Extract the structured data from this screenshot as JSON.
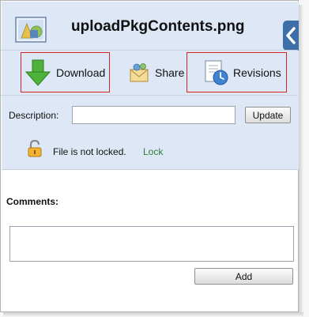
{
  "file": {
    "name": "uploadPkgContents.png",
    "thumbnail_icon": "image-file-icon"
  },
  "actions": {
    "download": {
      "label": "Download",
      "icon": "download-arrow-icon"
    },
    "share": {
      "label": "Share",
      "icon": "share-envelope-icon"
    },
    "revisions": {
      "label": "Revisions",
      "icon": "revisions-clock-icon"
    }
  },
  "description": {
    "label": "Description:",
    "value": "",
    "update_label": "Update"
  },
  "lock": {
    "icon": "unlocked-padlock-icon",
    "status": "File is not locked.",
    "action_label": "Lock"
  },
  "comments": {
    "label": "Comments:",
    "value": "",
    "add_label": "Add"
  },
  "colors": {
    "header_bg": "#dde7f5",
    "highlight_border": "#d42424",
    "lock_link": "#2e7d32",
    "download_arrow": "#3fa32a"
  }
}
